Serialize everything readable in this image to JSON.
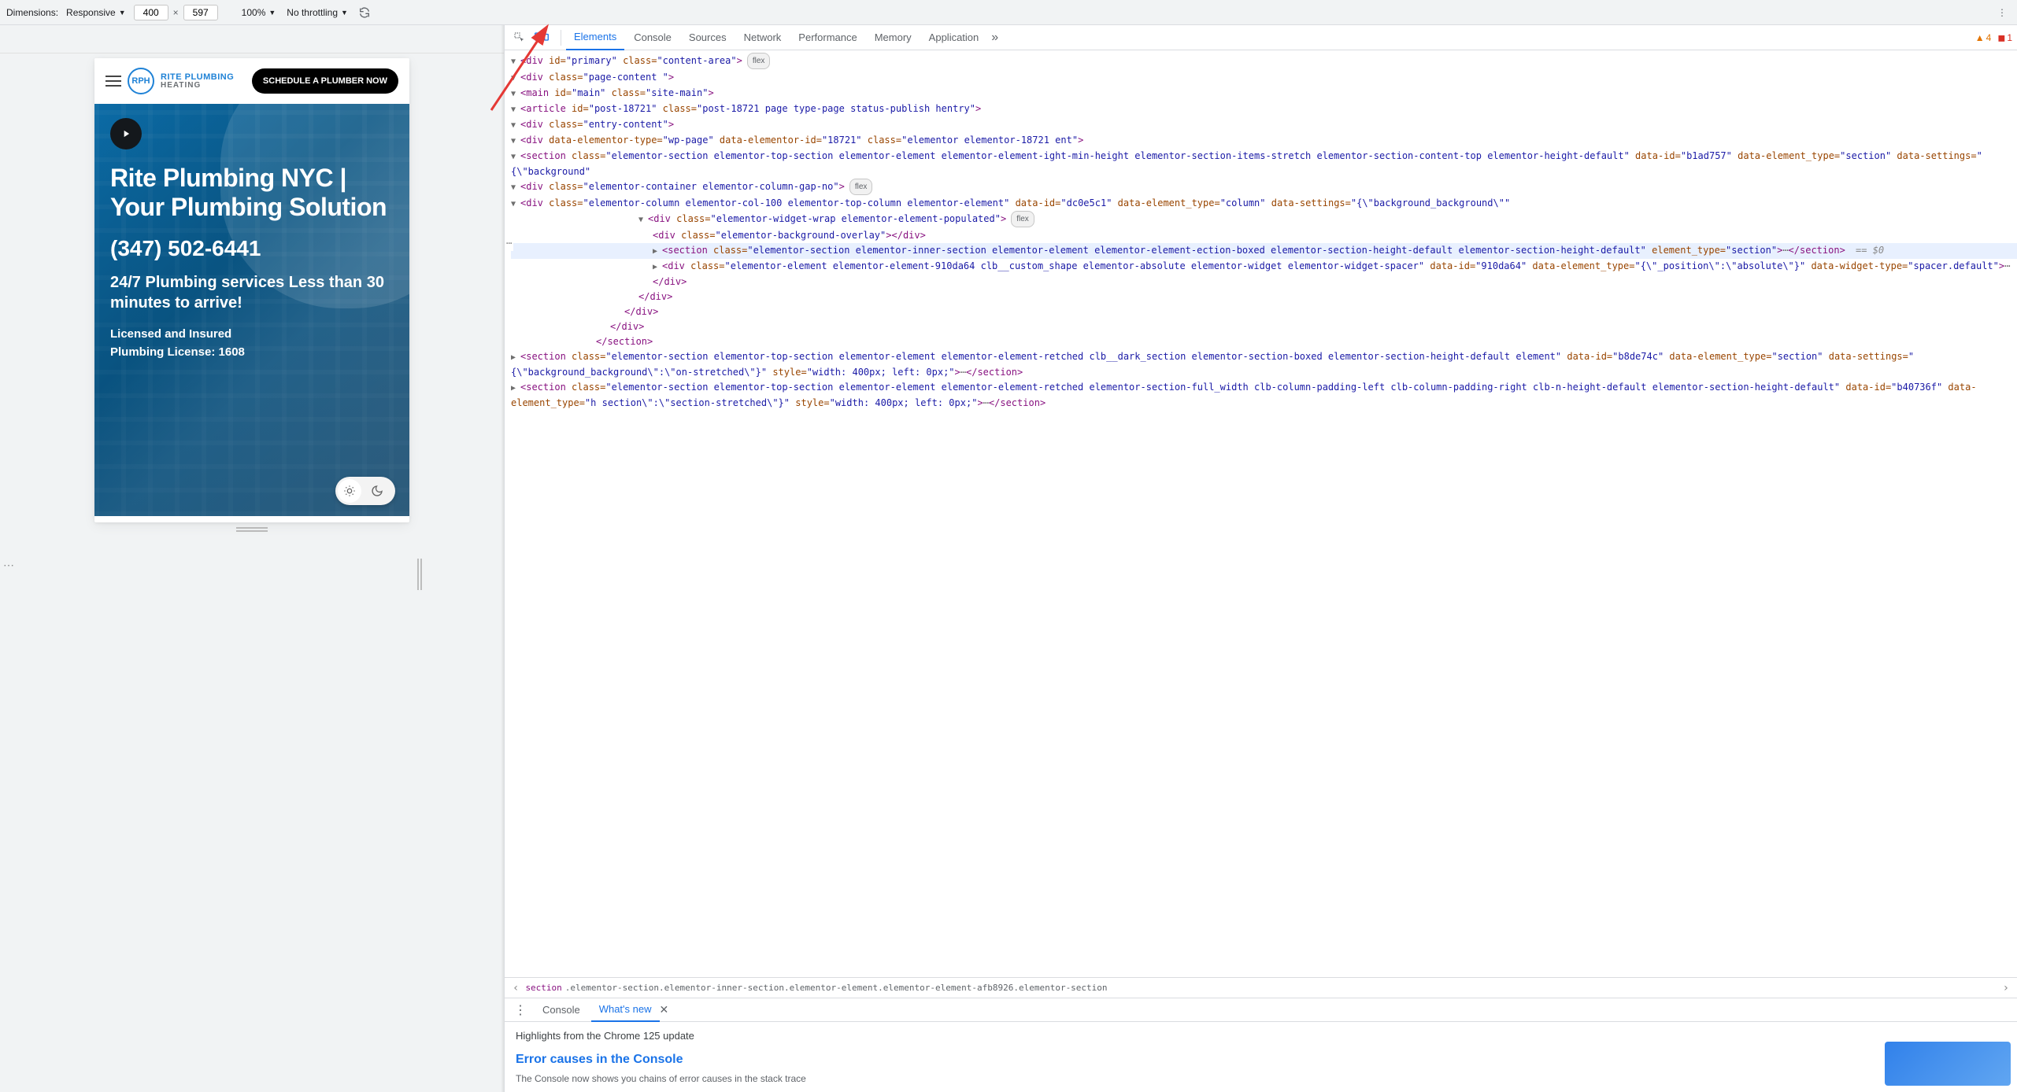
{
  "toolbar": {
    "dimensions_label": "Dimensions:",
    "device": "Responsive",
    "width": "400",
    "height": "597",
    "zoom": "100%",
    "throttling": "No throttling"
  },
  "site": {
    "brand_logo_text": "RPH",
    "brand_line1": "RITE PLUMBING",
    "brand_line2": "HEATING",
    "cta": "SCHEDULE A PLUMBER NOW",
    "hero_title": "Rite Plumbing NYC | Your Plumbing Solution",
    "phone": "(347) 502-6441",
    "sub1": "24/7 Plumbing services Less than 30 minutes to arrive!",
    "small1": "Licensed and Insured",
    "small2": "Plumbing License: 1608"
  },
  "devtools": {
    "tabs": [
      "Elements",
      "Console",
      "Sources",
      "Network",
      "Performance",
      "Memory",
      "Application"
    ],
    "active_tab": "Elements",
    "more_glyph": "»",
    "warnings": "4",
    "errors": "1",
    "breadcrumb_chev_left": "‹",
    "breadcrumb_chev_right": "›",
    "breadcrumb_tag": "section",
    "breadcrumb_rest": ".elementor-section.elementor-inner-section.elementor-element.elementor-element-afb8926.elementor-section",
    "drawer_tabs": [
      "Console",
      "What's new"
    ],
    "drawer_active": "What's new",
    "drawer_headline": "Highlights from the Chrome 125 update",
    "drawer_h3": "Error causes in the Console",
    "drawer_p": "The Console now shows you chains of error causes in the stack trace"
  },
  "dom": {
    "l1": {
      "twisty": "▼",
      "pre": "<",
      "tag": "div",
      "a1": " id=",
      "v1": "\"primary\"",
      "a2": " class=",
      "v2": "\"content-area\"",
      "post": ">",
      "pill": "flex"
    },
    "l2": {
      "twisty": "▼",
      "pre": "<",
      "tag": "div",
      "a1": " class=",
      "v1": "\"page-content \"",
      "post": ">"
    },
    "l3": {
      "twisty": "▼",
      "pre": "<",
      "tag": "main",
      "a1": " id=",
      "v1": "\"main\"",
      "a2": " class=",
      "v2": "\"site-main\"",
      "post": ">"
    },
    "l4": {
      "twisty": "▼",
      "pre": "<",
      "tag": "article",
      "a1": " id=",
      "v1": "\"post-18721\"",
      "a2": " class=",
      "v2": "\"post-18721 page type-page status-publish hentry\"",
      "post": ">"
    },
    "l5": {
      "twisty": "▼",
      "pre": "<",
      "tag": "div",
      "a1": " class=",
      "v1": "\"entry-content\"",
      "post": ">"
    },
    "l6": {
      "twisty": "▼",
      "pre": "<",
      "tag": "div",
      "a1": " data-elementor-type=",
      "v1": "\"wp-page\"",
      "a2": " data-elementor-id=",
      "v2": "\"18721\"",
      "a3": " class=",
      "v3": "\"elementor elementor-18721 ent\"",
      "post": ">"
    },
    "l7": {
      "twisty": "▼",
      "pre": "<",
      "tag": "section",
      "a1": " class=",
      "v1": "\"elementor-section elementor-top-section elementor-element elementor-element-ight-min-height elementor-section-items-stretch elementor-section-content-top elementor-height-default\"",
      "a2": " data-id=",
      "v2": "\"b1ad757\"",
      "a3": " data-element_type=",
      "v3": "\"section\"",
      "a4": " data-settings=",
      "v4": "\"{\\\"background\"",
      "post": ""
    },
    "l8": {
      "twisty": "▼",
      "pre": "<",
      "tag": "div",
      "a1": " class=",
      "v1": "\"elementor-container elementor-column-gap-no\"",
      "post": ">",
      "pill": "flex"
    },
    "l9": {
      "twisty": "▼",
      "pre": "<",
      "tag": "div",
      "a1": " class=",
      "v1": "\"elementor-column elementor-col-100 elementor-top-column elementor-element\"",
      "a2": " data-id=",
      "v2": "\"dc0e5c1\"",
      "a3": " data-element_type=",
      "v3": "\"column\"",
      "a4": " data-settings=",
      "v4": "\"{\\\"background_background\\\"\"",
      "post": ""
    },
    "l10": {
      "twisty": "▼",
      "pre": "<",
      "tag": "div",
      "a1": " class=",
      "v1": "\"elementor-widget-wrap elementor-element-populated\"",
      "post": ">",
      "pill": "flex"
    },
    "l11": {
      "pre": "<",
      "tag": "div",
      "a1": " class=",
      "v1": "\"elementor-background-overlay\"",
      "post": ">",
      "close": "</",
      "ctag": "div",
      "cpost": ">"
    },
    "l12": {
      "twisty": "▶",
      "pre": "<",
      "tag": "section",
      "a1": " class=",
      "v1": "\"elementor-section elementor-inner-section elementor-element elementor-element-ection-boxed elementor-section-height-default elementor-section-height-default\"",
      "a2": " element_type=",
      "v2": "\"section\"",
      "post": ">",
      "ell": "⋯",
      "close": "</",
      "ctag": "section",
      "cpost": ">",
      "eq": " == $0"
    },
    "l13": {
      "twisty": "▶",
      "pre": "<",
      "tag": "div",
      "a1": " class=",
      "v1": "\"elementor-element elementor-element-910da64 clb__custom_shape elementor-absolute elementor-widget elementor-widget-spacer\"",
      "a2": " data-id=",
      "v2": "\"910da64\"",
      "a3": " data-element_type=",
      "v3": "\"{\\\"_position\\\":\\\"absolute\\\"}\"",
      "a4": " data-widget-type=",
      "v4": "\"spacer.default\"",
      "post": ">",
      "ell": "⋯",
      "close": "</",
      "ctag": "div",
      "cpost": ">"
    },
    "l14": {
      "close": "</",
      "ctag": "div",
      "cpost": ">"
    },
    "l15": {
      "close": "</",
      "ctag": "div",
      "cpost": ">"
    },
    "l16": {
      "close": "</",
      "ctag": "div",
      "cpost": ">"
    },
    "l17": {
      "close": "</",
      "ctag": "section",
      "cpost": ">"
    },
    "l18": {
      "twisty": "▶",
      "pre": "<",
      "tag": "section",
      "a1": " class=",
      "v1": "\"elementor-section elementor-top-section elementor-element elementor-element-retched clb__dark_section elementor-section-boxed elementor-section-height-default element\"",
      "a2": " data-id=",
      "v2": "\"b8de74c\"",
      "a3": " data-element_type=",
      "v3": "\"section\"",
      "a4": " data-settings=",
      "v4": "\"{\\\"background_background\\\":\\\"on-stretched\\\"}\"",
      "a5": " style=",
      "v5": "\"width: 400px; left: 0px;\"",
      "post": ">",
      "ell": "⋯",
      "close": "</",
      "ctag": "section",
      "cpost": ">"
    },
    "l19": {
      "twisty": "▶",
      "pre": "<",
      "tag": "section",
      "a1": " class=",
      "v1": "\"elementor-section elementor-top-section elementor-element elementor-element-retched elementor-section-full_width clb-column-padding-left clb-column-padding-right clb-n-height-default elementor-section-height-default\"",
      "a2": " data-id=",
      "v2": "\"b40736f\"",
      "a3": " data-element_type=",
      "v3": "\"h section\\\":\\\"section-stretched\\\"}\"",
      "a4": " style=",
      "v4": "\"width: 400px; left: 0px;\"",
      "post": ">",
      "ell": "⋯",
      "close": "</",
      "ctag": "section",
      "cpost": ">"
    }
  }
}
